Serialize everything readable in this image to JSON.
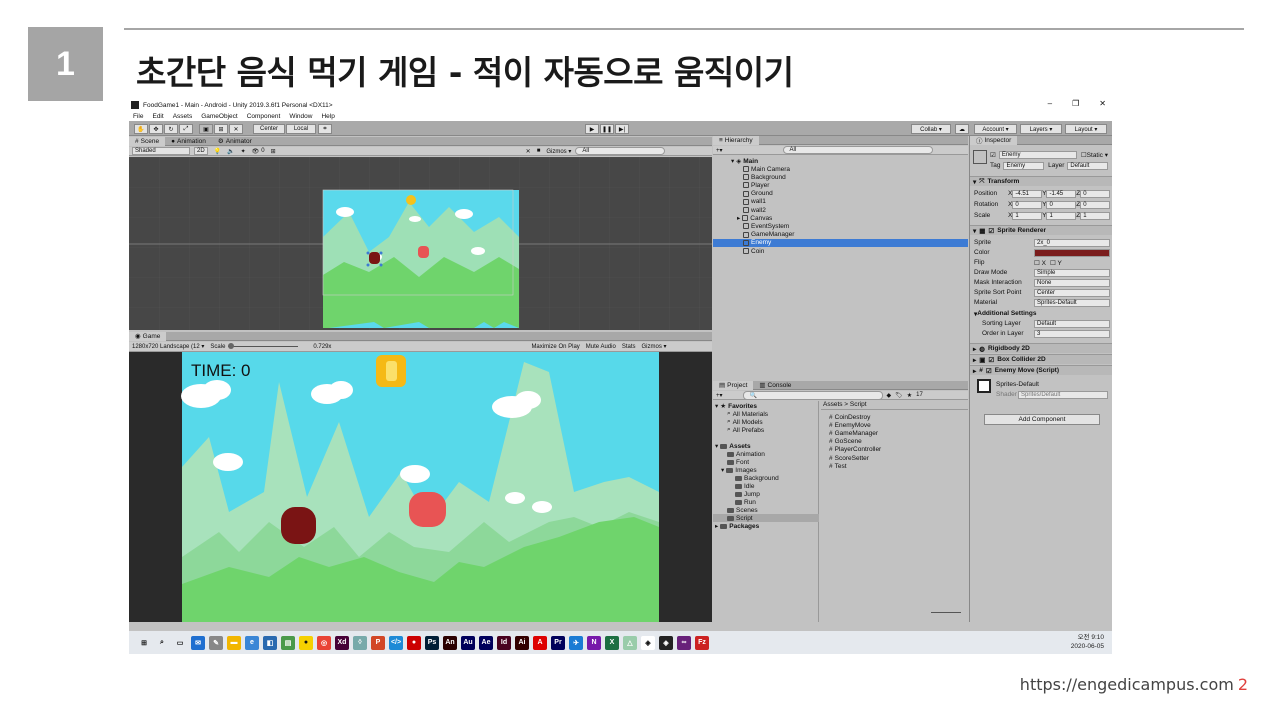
{
  "slide": {
    "number": "1",
    "title": "초간단 음식 먹기 게임 - 적이 자동으로 움직이기",
    "footer_url": "https://engedicampus.com",
    "footer_page": "2"
  },
  "window": {
    "title": "FoodGame1 - Main - Android - Unity 2019.3.6f1 Personal <DX11>",
    "controls": [
      "–",
      "❐",
      "✕"
    ]
  },
  "menu": [
    "File",
    "Edit",
    "Assets",
    "GameObject",
    "Component",
    "Window",
    "Help"
  ],
  "toolbar": {
    "center": "Center",
    "local": "Local",
    "collab": "Collab ▾",
    "account": "Account ▾",
    "layers": "Layers ▾",
    "layout": "Layout ▾"
  },
  "scene_tabs": [
    "Scene",
    "Animation",
    "Animator"
  ],
  "scene_bar": {
    "shading": "Shaded",
    "mode2d": "2D",
    "gizmos": "Gizmos ▾",
    "search": "All",
    "effects": "0"
  },
  "game_bar": {
    "tab": "Game",
    "resolution": "1280x720 Landscape (12 ▾",
    "scale_label": "Scale",
    "scale_value": "0.729x",
    "maximize": "Maximize On Play",
    "mute": "Mute Audio",
    "stats": "Stats",
    "gizmos": "Gizmos ▾"
  },
  "game_view": {
    "time_text": "TIME: 0"
  },
  "hierarchy": {
    "tab": "Hierarchy",
    "search": "All",
    "root": "Main",
    "items": [
      "Main Camera",
      "Background",
      "Player",
      "Ground",
      "wall1",
      "wall2",
      "Canvas",
      "EventSystem",
      "GameManager",
      "Enemy",
      "Coin"
    ]
  },
  "project": {
    "tabs": [
      "Project",
      "Console"
    ],
    "count": "17",
    "favorites": "Favorites",
    "fav_items": [
      "All Materials",
      "All Models",
      "All Prefabs"
    ],
    "assets": "Assets",
    "asset_items": [
      "Animation",
      "Font",
      "Images",
      "Background",
      "Idle",
      "Jump",
      "Run",
      "Scenes",
      "Script"
    ],
    "packages": "Packages",
    "breadcrumb": "Assets  >  Script",
    "scripts": [
      "CoinDestroy",
      "EnemyMove",
      "GameManager",
      "GoScene",
      "PlayerController",
      "ScoreSetter",
      "Test"
    ]
  },
  "inspector": {
    "tab": "Inspector",
    "name": "Enemy",
    "static": "Static ▾",
    "tag_label": "Tag",
    "tag": "Enemy",
    "layer_label": "Layer",
    "layer": "Default",
    "transform": "Transform",
    "position_label": "Position",
    "rotation_label": "Rotation",
    "scale_label": "Scale",
    "pos": [
      "-4.51",
      "-1.45",
      "0"
    ],
    "rot": [
      "0",
      "0",
      "0"
    ],
    "scl": [
      "1",
      "1",
      "1"
    ],
    "sprite_renderer": "Sprite Renderer",
    "sprite_label": "Sprite",
    "sprite": "2x_0",
    "color_label": "Color",
    "color_value": "#7a1c1c",
    "flip_label": "Flip",
    "drawmode_label": "Draw Mode",
    "drawmode": "Simple",
    "mask_label": "Mask Interaction",
    "mask": "None",
    "sortpoint_label": "Sprite Sort Point",
    "sortpoint": "Center",
    "material_label": "Material",
    "material": "Sprites-Default",
    "additional": "Additional Settings",
    "sortlayer_label": "Sorting Layer",
    "sortlayer": "Default",
    "order_label": "Order in Layer",
    "order": "3",
    "rigidbody": "Rigidbody 2D",
    "boxcollider": "Box Collider 2D",
    "enemymove": "Enemy Move (Script)",
    "mat_name": "Sprites-Default",
    "shader_label": "Shader",
    "shader": "Sprites/Default",
    "add_component": "Add Component"
  },
  "clock": {
    "time": "오전 9:10",
    "date": "2020-06-05"
  },
  "colors": {
    "sky": "#57d9ea",
    "ground": "#6fd46c",
    "enemy_dark": "#7a1414",
    "enemy_red": "#e85454",
    "selected": "#3d7bd4"
  }
}
